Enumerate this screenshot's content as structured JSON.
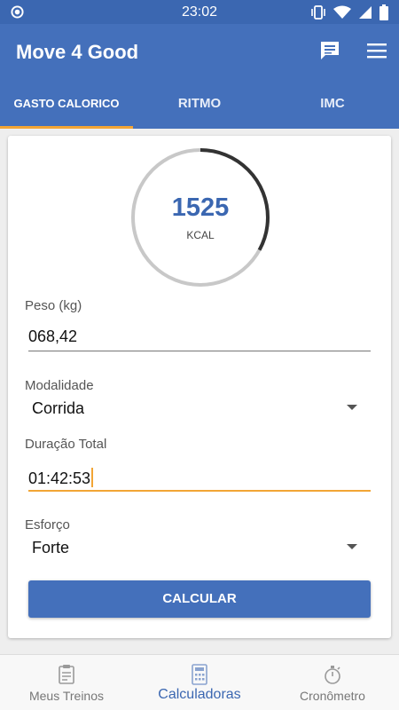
{
  "status_bar": {
    "time": "23:02"
  },
  "app_bar": {
    "title": "Move 4 Good"
  },
  "tabs": [
    {
      "label": "GASTO CALORICO",
      "active": true
    },
    {
      "label": "RITMO",
      "active": false
    },
    {
      "label": "IMC",
      "active": false
    }
  ],
  "result": {
    "value": "1525",
    "unit": "KCAL",
    "ring_progress": 0.33
  },
  "form": {
    "peso_label": "Peso (kg)",
    "peso_value": "068,42",
    "modalidade_label": "Modalidade",
    "modalidade_value": "Corrida",
    "duracao_label": "Duração Total",
    "duracao_value": "01:42:53",
    "esforco_label": "Esforço",
    "esforco_value": "Forte",
    "button_label": "CALCULAR"
  },
  "bottom_nav": [
    {
      "label": "Meus Treinos",
      "icon": "clipboard-icon",
      "active": false
    },
    {
      "label": "Calculadoras",
      "icon": "calculator-icon",
      "active": true
    },
    {
      "label": "Cronômetro",
      "icon": "stopwatch-icon",
      "active": false
    }
  ],
  "colors": {
    "primary": "#4470bb",
    "accent": "#f2a535",
    "ring_track": "#c8c8c8",
    "ring_fill": "#333333"
  }
}
